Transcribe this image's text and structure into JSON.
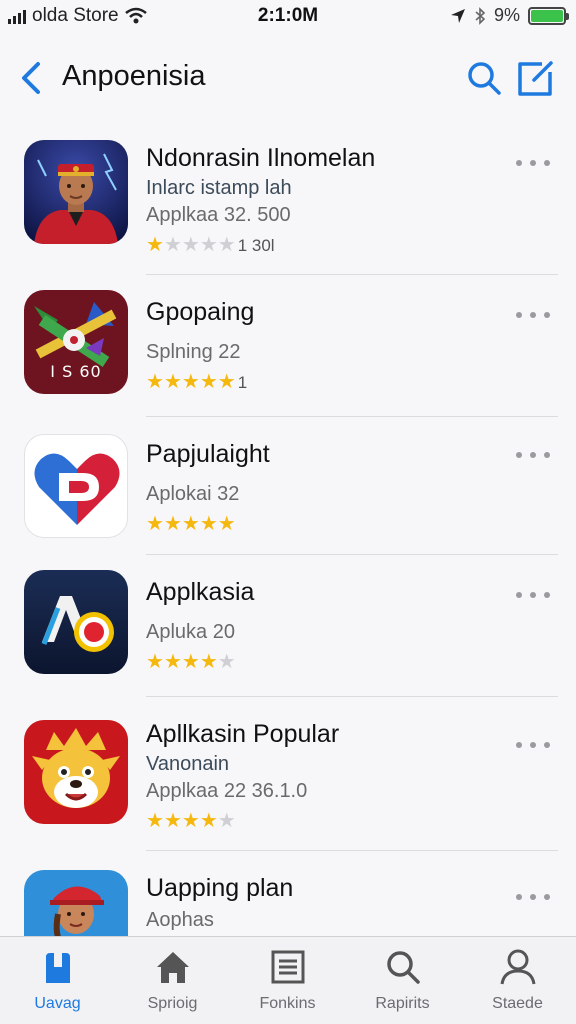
{
  "status_bar": {
    "carrier": "olda Store",
    "time": "2:1:0M",
    "battery": "9%"
  },
  "nav": {
    "title": "Anpoenisia",
    "back_icon": "chevron-left-icon",
    "search_icon": "search-icon",
    "share_icon": "share-icon"
  },
  "apps": [
    {
      "name": "Ndonrasin Ilnomelan",
      "subtitle": "Inlarc istamp lah",
      "meta": "Applkaa 32. 500",
      "stars": 0.5,
      "rating_text": "1 30l",
      "icon": "avatar-hero-icon"
    },
    {
      "name": "Gpopaing",
      "subtitle": "",
      "meta": "Splning 22",
      "stars": 4.5,
      "rating_text": "1",
      "icon": "game-crossed-icon",
      "icon_text": "I S 60"
    },
    {
      "name": "Papjulaight",
      "subtitle": "",
      "meta": "Aplokai 32",
      "stars": 5,
      "rating_text": "",
      "icon": "heart-d-icon"
    },
    {
      "name": "Applkasia",
      "subtitle": "",
      "meta": "Apluka 20",
      "stars": 3.5,
      "rating_text": "",
      "icon": "a-circle-icon"
    },
    {
      "name": "Apllkasin Popular",
      "subtitle": "Vanonain",
      "meta": "Applkaa 22 36.1.0",
      "stars": 3.5,
      "rating_text": "",
      "icon": "cartoon-dog-icon"
    },
    {
      "name": "Uapping plan",
      "subtitle": "",
      "meta": "Aophas",
      "stars": null,
      "rating_text": "",
      "icon": "avatar-girl-icon"
    }
  ],
  "tabs": [
    {
      "label": "Uavag",
      "icon": "today-icon",
      "active": true
    },
    {
      "label": "Sprioig",
      "icon": "home-icon",
      "active": false
    },
    {
      "label": "Fonkins",
      "icon": "list-icon",
      "active": false
    },
    {
      "label": "Rapirits",
      "icon": "search-icon",
      "active": false
    },
    {
      "label": "Staede",
      "icon": "person-icon",
      "active": false
    }
  ],
  "colors": {
    "accent": "#1f7ae0",
    "star": "#f5b80f",
    "battery": "#3bc24b"
  }
}
